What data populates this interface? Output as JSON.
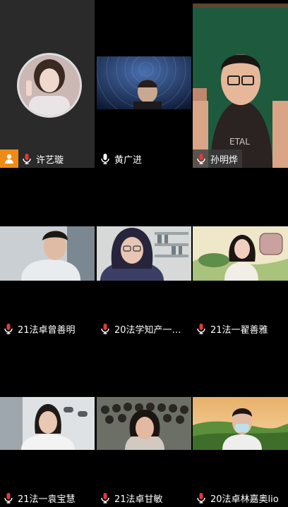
{
  "participants": [
    {
      "name": "许艺璇",
      "host": true
    },
    {
      "name": "黄广进"
    },
    {
      "name": "孙明烨"
    },
    {
      "name": "21法卓曾善明"
    },
    {
      "name": "20法学知产一…"
    },
    {
      "name": "21法一翟善雅"
    },
    {
      "name": "21法一袁宝慧"
    },
    {
      "name": "21法卓甘敏"
    },
    {
      "name": "20法卓林嘉奥lio"
    }
  ],
  "icons": {
    "mic": "microphone-icon",
    "host": "person-icon"
  },
  "colors": {
    "host_badge": "#f08a16",
    "mic_red": "#e23a3a"
  }
}
